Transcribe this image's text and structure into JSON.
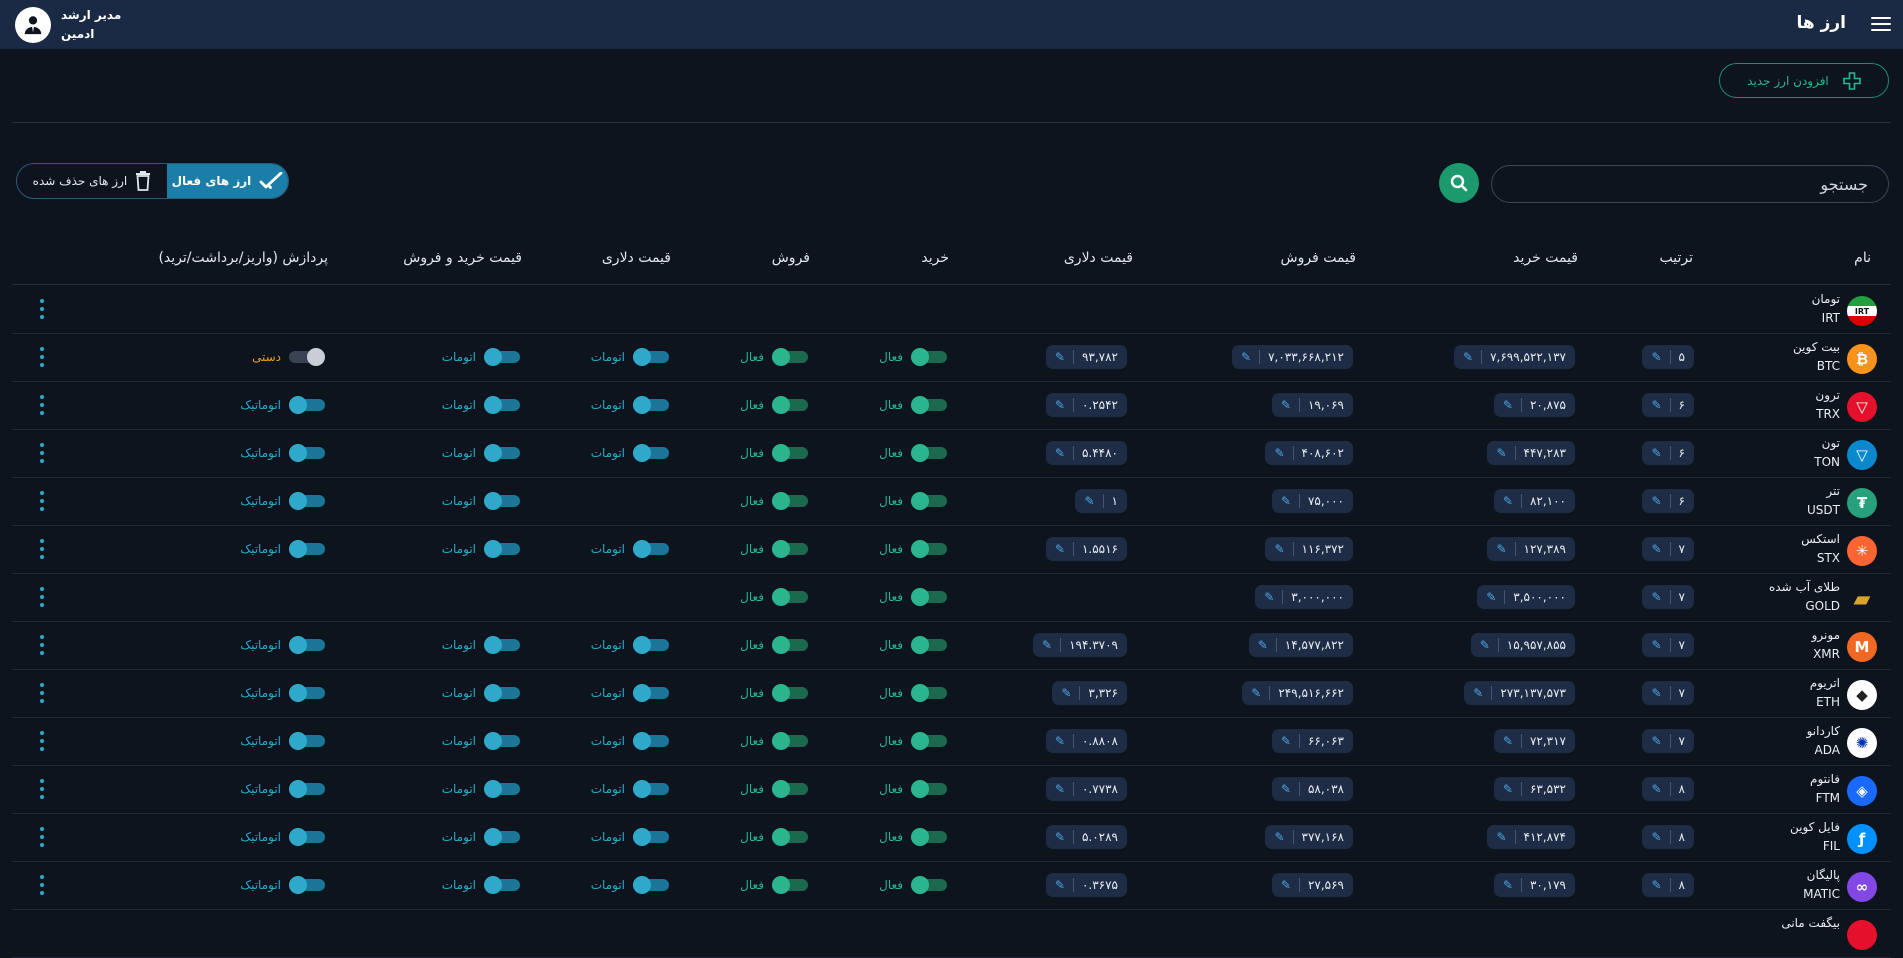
{
  "header": {
    "title": "ارز ها",
    "user_role": "مدیر ارشد",
    "user_name": "ادمین"
  },
  "toolbar": {
    "add_label": "افزودن ارز جدید",
    "search_placeholder": "جستجو",
    "active_label": "ارز های فعال",
    "deleted_label": "ارز های حذف شده"
  },
  "columns": {
    "name": "نام",
    "order": "ترتیب",
    "buy_price": "قیمت خرید",
    "sell_price": "قیمت فروش",
    "usd_price": "قیمت دلاری",
    "buy": "خرید",
    "sell": "فروش",
    "usd_price_mode": "قیمت دلاری",
    "buy_sell_price_mode": "قیمت خرید و فروش",
    "processing": "پردازش (واریز/برداشت/ترید)"
  },
  "colors": {
    "accent": "#1c9a6d",
    "toggle_cyan": "#2ea9c9",
    "header_bg": "#1b2a44"
  },
  "rows": [
    {
      "fa": "تومان",
      "sym": "IRT",
      "icon": "iran-flag-icon",
      "color": "#ffffff",
      "order": null,
      "buy": null,
      "sell": null,
      "usd": null,
      "buy_on": null,
      "sell_on": null,
      "usd_mode": null,
      "price_mode": null,
      "proc": null
    },
    {
      "fa": "بیت کوین",
      "sym": "BTC",
      "icon": "bitcoin-icon",
      "color": "#f7931a",
      "order": "۵",
      "buy": "۷,۶۹۹,۵۲۲,۱۳۷",
      "sell": "۷,۰۳۳,۶۶۸,۲۱۲",
      "usd": "۹۳,۷۸۲",
      "buy_on": "فعال",
      "sell_on": "فعال",
      "usd_mode": "اتومات",
      "price_mode": "اتومات",
      "proc": "دستی"
    },
    {
      "fa": "ترون",
      "sym": "TRX",
      "icon": "tron-icon",
      "color": "#e5112a",
      "order": "۶",
      "buy": "۲۰,۸۷۵",
      "sell": "۱۹,۰۶۹",
      "usd": "۰.۲۵۴۲",
      "buy_on": "فعال",
      "sell_on": "فعال",
      "usd_mode": "اتومات",
      "price_mode": "اتومات",
      "proc": "اتوماتیک"
    },
    {
      "fa": "تون",
      "sym": "TON",
      "icon": "toncoin-icon",
      "color": "#0a88cc",
      "order": "۶",
      "buy": "۴۴۷,۲۸۳",
      "sell": "۴۰۸,۶۰۲",
      "usd": "۵.۴۴۸۰",
      "buy_on": "فعال",
      "sell_on": "فعال",
      "usd_mode": "اتومات",
      "price_mode": "اتومات",
      "proc": "اتوماتیک"
    },
    {
      "fa": "تتر",
      "sym": "USDT",
      "icon": "tether-icon",
      "color": "#26a17b",
      "order": "۶",
      "buy": "۸۲,۱۰۰",
      "sell": "۷۵,۰۰۰",
      "usd": "۱",
      "buy_on": "فعال",
      "sell_on": "فعال",
      "usd_mode": null,
      "price_mode": "اتومات",
      "proc": "اتوماتیک"
    },
    {
      "fa": "استکس",
      "sym": "STX",
      "icon": "stacks-icon",
      "color": "#fc6432",
      "order": "۷",
      "buy": "۱۲۷,۳۸۹",
      "sell": "۱۱۶,۳۷۲",
      "usd": "۱.۵۵۱۶",
      "buy_on": "فعال",
      "sell_on": "فعال",
      "usd_mode": "اتومات",
      "price_mode": "اتومات",
      "proc": "اتوماتیک"
    },
    {
      "fa": "طلای آب شده",
      "sym": "GOLD",
      "icon": "gold-bar-icon",
      "color": "#d8a52a",
      "order": "۷",
      "buy": "۳,۵۰۰,۰۰۰",
      "sell": "۳,۰۰۰,۰۰۰",
      "usd": null,
      "buy_on": "فعال",
      "sell_on": "فعال",
      "usd_mode": null,
      "price_mode": null,
      "proc": null
    },
    {
      "fa": "مونرو",
      "sym": "XMR",
      "icon": "monero-icon",
      "color": "#f26822",
      "order": "۷",
      "buy": "۱۵,۹۵۷,۸۵۵",
      "sell": "۱۴,۵۷۷,۸۲۲",
      "usd": "۱۹۴.۳۷۰۹",
      "buy_on": "فعال",
      "sell_on": "فعال",
      "usd_mode": "اتومات",
      "price_mode": "اتومات",
      "proc": "اتوماتیک"
    },
    {
      "fa": "اتریوم",
      "sym": "ETH",
      "icon": "ethereum-icon",
      "color": "#ffffff",
      "order": "۷",
      "buy": "۲۷۳,۱۳۷,۵۷۳",
      "sell": "۲۴۹,۵۱۶,۶۶۲",
      "usd": "۳,۳۲۶",
      "buy_on": "فعال",
      "sell_on": "فعال",
      "usd_mode": "اتومات",
      "price_mode": "اتومات",
      "proc": "اتوماتیک"
    },
    {
      "fa": "کاردانو",
      "sym": "ADA",
      "icon": "cardano-icon",
      "color": "#ffffff",
      "order": "۷",
      "buy": "۷۲,۳۱۷",
      "sell": "۶۶,۰۶۳",
      "usd": "۰.۸۸۰۸",
      "buy_on": "فعال",
      "sell_on": "فعال",
      "usd_mode": "اتومات",
      "price_mode": "اتومات",
      "proc": "اتوماتیک"
    },
    {
      "fa": "فانتوم",
      "sym": "FTM",
      "icon": "fantom-icon",
      "color": "#1969ff",
      "order": "۸",
      "buy": "۶۳,۵۳۲",
      "sell": "۵۸,۰۳۸",
      "usd": "۰.۷۷۳۸",
      "buy_on": "فعال",
      "sell_on": "فعال",
      "usd_mode": "اتومات",
      "price_mode": "اتومات",
      "proc": "اتوماتیک"
    },
    {
      "fa": "فایل کوین",
      "sym": "FIL",
      "icon": "filecoin-icon",
      "color": "#0090ff",
      "order": "۸",
      "buy": "۴۱۲,۸۷۴",
      "sell": "۳۷۷,۱۶۸",
      "usd": "۵.۰۲۸۹",
      "buy_on": "فعال",
      "sell_on": "فعال",
      "usd_mode": "اتومات",
      "price_mode": "اتومات",
      "proc": "اتوماتیک"
    },
    {
      "fa": "پالیگان",
      "sym": "MATIC",
      "icon": "polygon-icon",
      "color": "#8247e5",
      "order": "۸",
      "buy": "۳۰,۱۷۹",
      "sell": "۲۷,۵۶۹",
      "usd": "۰.۳۶۷۵",
      "buy_on": "فعال",
      "sell_on": "فعال",
      "usd_mode": "اتومات",
      "price_mode": "اتومات",
      "proc": "اتوماتیک"
    },
    {
      "fa": "بیگفت مانی",
      "sym": "",
      "icon": "partial-coin-icon",
      "color": "#e5112a",
      "order": null,
      "buy": null,
      "sell": null,
      "usd": null,
      "buy_on": null,
      "sell_on": null,
      "usd_mode": null,
      "price_mode": null,
      "proc": null
    }
  ]
}
